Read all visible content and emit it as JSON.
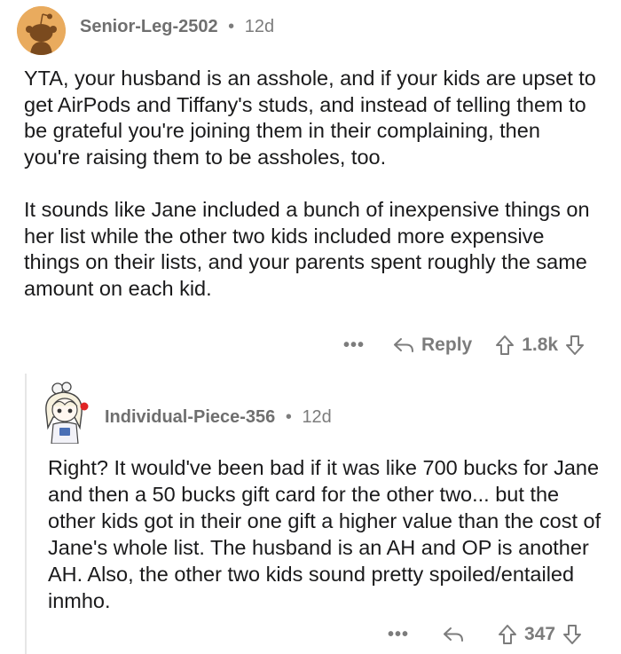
{
  "comments": [
    {
      "author": "Senior-Leg-2502",
      "separator": "•",
      "age": "12d",
      "paragraphs": [
        "YTA, your husband is an asshole, and if your kids are upset to get AirPods and Tiffany's studs, and instead of telling them to be grateful you're joining them in their complaining, then you're raising them to be assholes, too.",
        "It sounds like Jane included a bunch of inexpensive things on her list while the other two kids included more expensive things on their lists, and your parents spent roughly the same amount on each kid."
      ],
      "more": "•••",
      "reply_label": "Reply",
      "score": "1.8k"
    },
    {
      "author": "Individual-Piece-356",
      "separator": "•",
      "age": "12d",
      "paragraphs": [
        "Right? It would've been bad if it was like 700 bucks for Jane and then a 50 bucks gift card for the other two... but the other kids got in their one gift a higher value than the cost of Jane's whole list. The husband is an AH and OP is another AH. Also, the other two kids sound pretty spoiled/entailed inmho."
      ],
      "more": "•••",
      "score": "347"
    }
  ],
  "colors": {
    "avatar1_bg": "#e9ab5e",
    "meta_text": "#7c7c7c",
    "body_text": "#1a1a1b",
    "thread_line": "#e6e6e6"
  }
}
